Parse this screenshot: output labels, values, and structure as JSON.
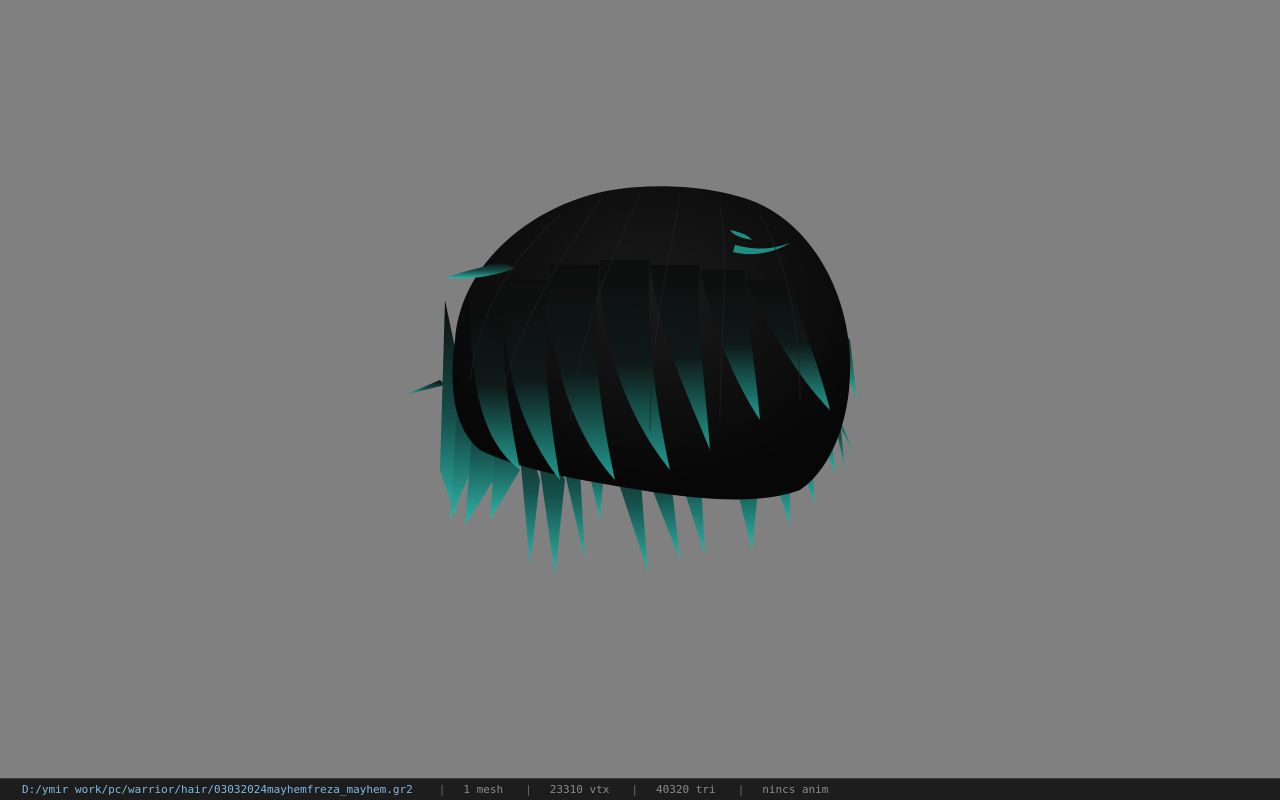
{
  "viewport": {
    "background_color": "#808080",
    "hair_base_color": "#0d0d0d",
    "hair_tip_color": "#1f8f86"
  },
  "statusbar": {
    "file_path": "D:/ymir work/pc/warrior/hair/03032024mayhemfreza_mayhem.gr2",
    "separator": "|",
    "mesh_count": "1 mesh",
    "vertex_count": "23310 vtx",
    "triangle_count": "40320 tri",
    "anim_status": "nincs anim"
  }
}
